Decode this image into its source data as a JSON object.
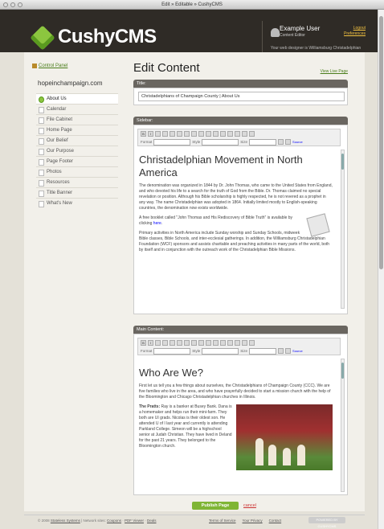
{
  "window": {
    "title": "Edit » Editable » CushyCMS"
  },
  "header": {
    "logo": "CushyCMS",
    "user_name": "Example User",
    "user_role": "Content Editor",
    "logout": "Logout",
    "preferences": "Preferences",
    "designer_note": "Your web designer is Williamsburg Christadelphian Foundation"
  },
  "sidebar": {
    "control_panel": "Control Panel",
    "site_name": "hopeinchampaign.com",
    "items": [
      {
        "label": "About Us"
      },
      {
        "label": "Calendar"
      },
      {
        "label": "File Cabinet"
      },
      {
        "label": "Home Page"
      },
      {
        "label": "Our Belief"
      },
      {
        "label": "Our Purpose"
      },
      {
        "label": "Page Footer"
      },
      {
        "label": "Photos"
      },
      {
        "label": "Resources"
      },
      {
        "label": "Title Banner"
      },
      {
        "label": "What's New"
      }
    ]
  },
  "main": {
    "page_title": "Edit Content",
    "view_live": "View Live Page",
    "title_label": "Title:",
    "title_value": "Christadelphians of Champaign County | About Us",
    "sidebar_label": "Sidebar:",
    "main_label": "Main Content:",
    "toolbar": {
      "format": "Format",
      "style": "Style",
      "size": "Size",
      "source": "Source"
    },
    "sidebar_editor": {
      "heading": "Christadelphian Movement in North America",
      "p1": "The denomination was organized in 1844 by Dr. John Thomas, who came to the United States from England, and who devoted his life to a search for the truth of God from the Bible. Dr. Thomas claimed no special revelation or position. Although his Bible scholarship is highly respected, he is not revered as a prophet in any way. The name Christadelphian was adopted in 1864. Initially limited mostly to English-speaking countries, the denomination now exists worldwide.",
      "p2": "A free booklet called \"John Thomas and His Rediscovery of Bible Truth\" is available by clicking ",
      "p2_link": "here",
      "p3": "Primary activities in North America include Sunday worship and Sunday Schools, midweek Bible classes, Bible Schools, and inter-ecclesial gatherings. In addition, the Williamsburg Christadelphian Foundation (WCF) sponsors and assists charitable and preaching activities in many parts of the world, both by itself and in conjunction with the outreach work of the Christadelphian Bible Missions."
    },
    "main_editor": {
      "heading": "Who Are We?",
      "p1": "First let us tell you a few things about ourselves, the Christadelphians of Champaign County (CCC). We are five families who live in the area, and who have prayerfully decided to start a mission church with the help of the Bloomington and Chicago Christadelphian churches in Illinois.",
      "p2_bold": "The Pratts:",
      "p2": " Ray is a banker at Busey Bank. Dana is a homemaker and helps run their mini-farm. They both are UI grads. Nicolas is their oldest son. He attended U of I last year and currently is attending Parkland College. Simeon will be a highschool senior at Judah Christian. They have lived in Deland for the past 21 years. They belonged to the Bloomington church."
    },
    "publish": "Publish Page",
    "cancel": "cancel"
  },
  "footer": {
    "copyright": "© 2008 ",
    "company": "Stateless Systems",
    "network_label": " | Network sites: ",
    "network_links": [
      "Coupons",
      "PDF Viewer",
      "Deals"
    ],
    "links": [
      "Terms of Service",
      "Your Privacy",
      "Contact"
    ],
    "badge": "POWERED BY CUSHYCMS"
  }
}
